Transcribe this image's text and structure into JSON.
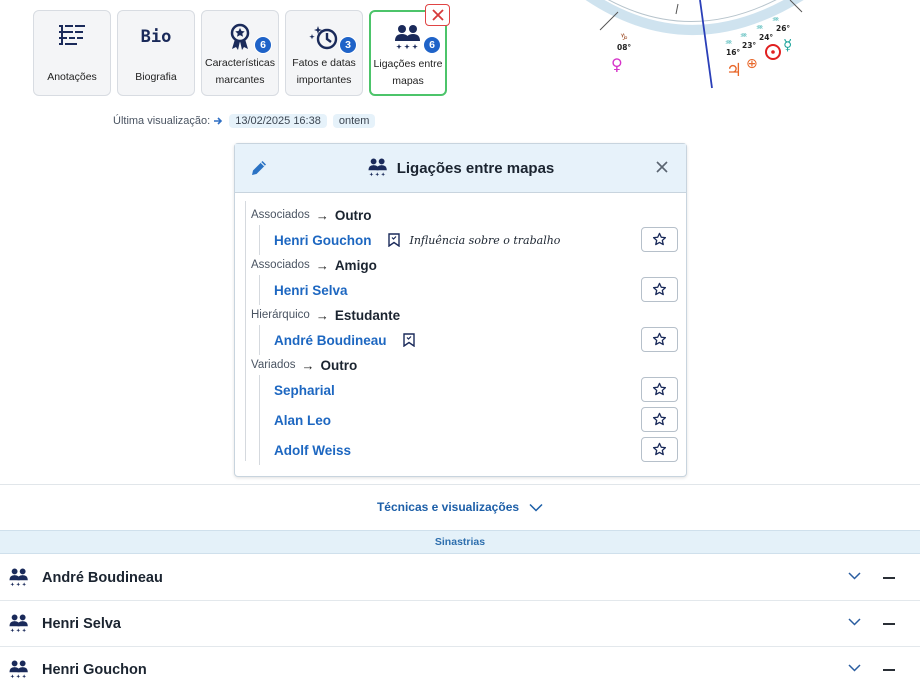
{
  "tiles": [
    {
      "label": "Anotações",
      "icon": "notes-icon",
      "badge": ""
    },
    {
      "label": "Biografia",
      "icon": "bio-icon",
      "icon_text": "Bio",
      "badge": ""
    },
    {
      "label1": "Características",
      "label2": "marcantes",
      "icon": "award-icon",
      "badge": "6"
    },
    {
      "label1": "Fatos e datas",
      "label2": "importantes",
      "icon": "history-icon",
      "badge": "3"
    },
    {
      "label1": "Ligações entre",
      "label2": "mapas",
      "icon": "people-icon",
      "badge": "6"
    }
  ],
  "last_view": {
    "label": "Última visualização:",
    "date": "13/02/2025 16:38",
    "relative": "ontem"
  },
  "chart_labels": {
    "d1": "08°",
    "d2": "16°",
    "d3": "23°",
    "d4": "24°",
    "d5": "26°"
  },
  "panel": {
    "title": "Ligações entre mapas",
    "groups": [
      {
        "category": "Associados",
        "sub": "Outro",
        "items": [
          {
            "name": "Henri Gouchon",
            "note": "Influência sobre o trabalho"
          }
        ]
      },
      {
        "category": "Associados",
        "sub": "Amigo",
        "items": [
          {
            "name": "Henri Selva"
          }
        ]
      },
      {
        "category": "Hierárquico",
        "sub": "Estudante",
        "items": [
          {
            "name": "André Boudineau"
          }
        ]
      },
      {
        "category": "Variados",
        "sub": "Outro",
        "items": [
          {
            "name": "Sepharial"
          },
          {
            "name": "Alan Leo"
          },
          {
            "name": "Adolf Weiss"
          }
        ]
      }
    ]
  },
  "techniques": {
    "label": "Técnicas e visualizações"
  },
  "synastries": {
    "title": "Sinastrias",
    "items": [
      {
        "name": "André Boudineau"
      },
      {
        "name": "Henri Selva"
      },
      {
        "name": "Henri Gouchon"
      }
    ]
  },
  "colors": {
    "accent": "#1f63c8",
    "active_border": "#4cc46a",
    "link": "#1d67c1",
    "header_bg": "#e7f2fa"
  }
}
